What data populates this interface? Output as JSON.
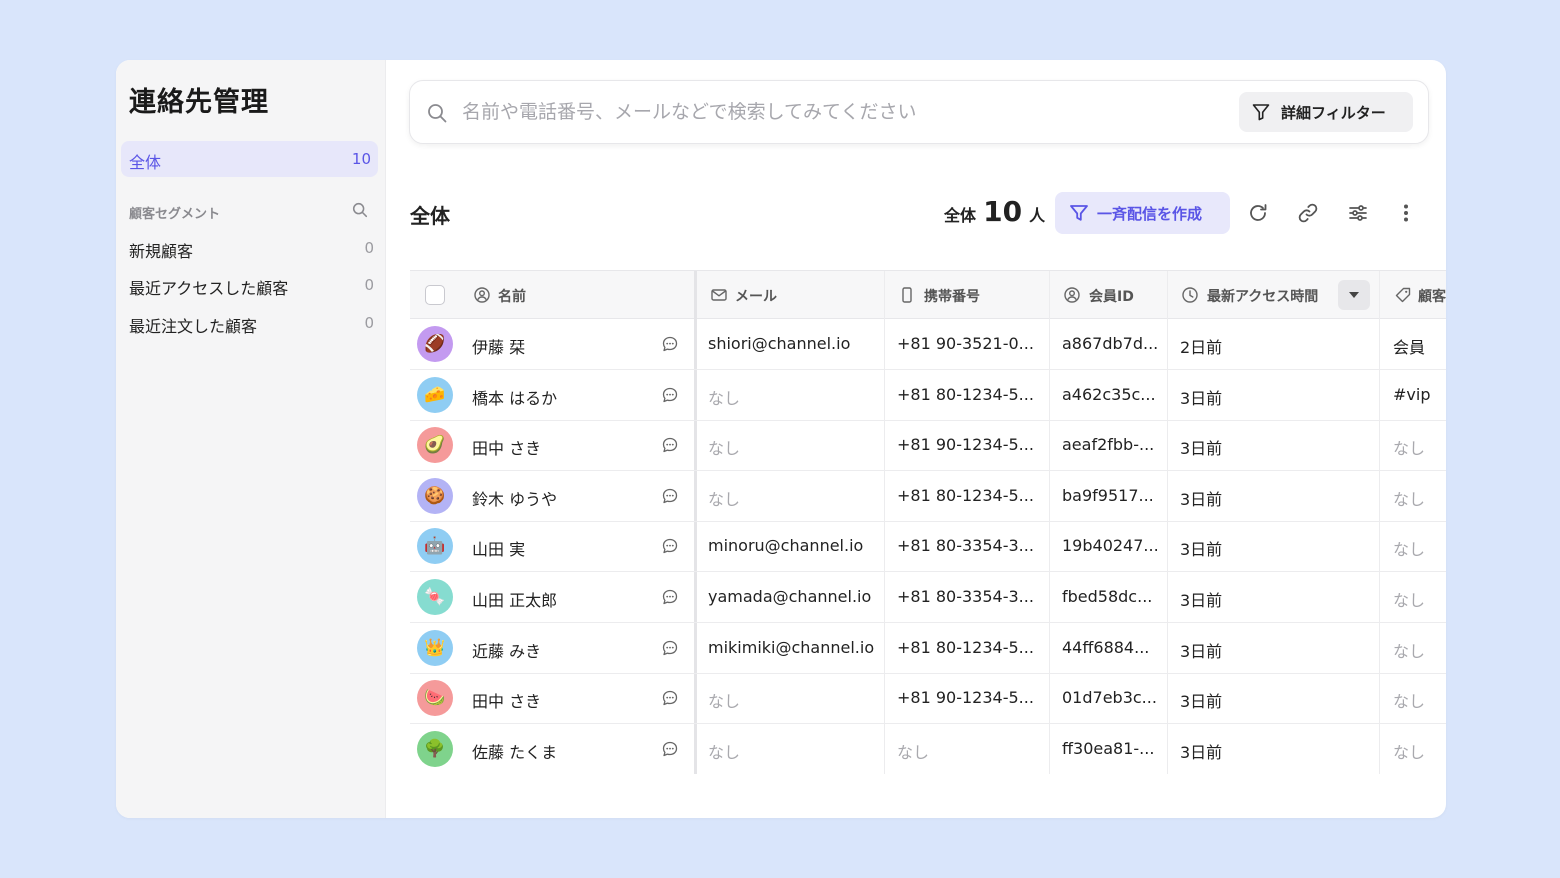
{
  "sidebar": {
    "title": "連絡先管理",
    "all": {
      "label": "全体",
      "count": "10"
    },
    "segment_header": "顧客セグメント",
    "segments": [
      {
        "label": "新規顧客",
        "count": "0"
      },
      {
        "label": "最近アクセスした顧客",
        "count": "0"
      },
      {
        "label": "最近注文した顧客",
        "count": "0"
      }
    ]
  },
  "search": {
    "placeholder": "名前や電話番号、メールなどで検索してみてください",
    "filter_label": "詳細フィルター"
  },
  "section": {
    "title": "全体",
    "count_prefix": "全体",
    "count_number": "10",
    "count_suffix": "人",
    "broadcast_label": "一斉配信を作成"
  },
  "table": {
    "columns": [
      {
        "label": "名前",
        "icon": "user-circle-icon"
      },
      {
        "label": "メール",
        "icon": "mail-icon"
      },
      {
        "label": "携帯番号",
        "icon": "mobile-icon"
      },
      {
        "label": "会員ID",
        "icon": "member-icon"
      },
      {
        "label": "最新アクセス時間",
        "icon": "clock-icon"
      },
      {
        "label": "顧客",
        "icon": "tag-icon"
      }
    ],
    "rows": [
      {
        "avatar": "🏈",
        "color": "#c39af0",
        "name": "伊藤 栞",
        "email": "shiori@channel.io",
        "phone": "+81 90-3521-0...",
        "member_id": "a867db7d...",
        "access": "2日前",
        "tag": "会員"
      },
      {
        "avatar": "🧀",
        "color": "#8fcdf3",
        "name": "橋本 はるか",
        "email": "なし",
        "phone": "+81 80-1234-5...",
        "member_id": "a462c35c...",
        "access": "3日前",
        "tag": "#vip"
      },
      {
        "avatar": "🥑",
        "color": "#f59a9a",
        "name": "田中 さき",
        "email": "なし",
        "phone": "+81 90-1234-5...",
        "member_id": "aeaf2fbb-...",
        "access": "3日前",
        "tag": "なし"
      },
      {
        "avatar": "🍪",
        "color": "#b3b3f5",
        "name": "鈴木 ゆうや",
        "email": "なし",
        "phone": "+81 80-1234-5...",
        "member_id": "ba9f9517...",
        "access": "3日前",
        "tag": "なし"
      },
      {
        "avatar": "🤖",
        "color": "#8fcdf3",
        "name": "山田 実",
        "email": "minoru@channel.io",
        "phone": "+81 80-3354-3...",
        "member_id": "19b40247...",
        "access": "3日前",
        "tag": "なし"
      },
      {
        "avatar": "🍬",
        "color": "#86dcd0",
        "name": "山田 正太郎",
        "email": "yamada@channel.io",
        "phone": "+81 80-3354-3...",
        "member_id": "fbed58dc...",
        "access": "3日前",
        "tag": "なし"
      },
      {
        "avatar": "👑",
        "color": "#8fcdf3",
        "name": "近藤 みき",
        "email": "mikimiki@channel.io",
        "phone": "+81 80-1234-5...",
        "member_id": "44ff6884...",
        "access": "3日前",
        "tag": "なし"
      },
      {
        "avatar": "🍉",
        "color": "#f59a9a",
        "name": "田中 さき",
        "email": "なし",
        "phone": "+81 90-1234-5...",
        "member_id": "01d7eb3c...",
        "access": "3日前",
        "tag": "なし"
      },
      {
        "avatar": "🌳",
        "color": "#7fd38c",
        "name": "佐藤 たくま",
        "email": "なし",
        "phone": "なし",
        "member_id": "ff30ea81-...",
        "access": "3日前",
        "tag": "なし"
      }
    ]
  },
  "colors": {
    "accent": "#5a55e6",
    "background": "#d9e5fb"
  }
}
